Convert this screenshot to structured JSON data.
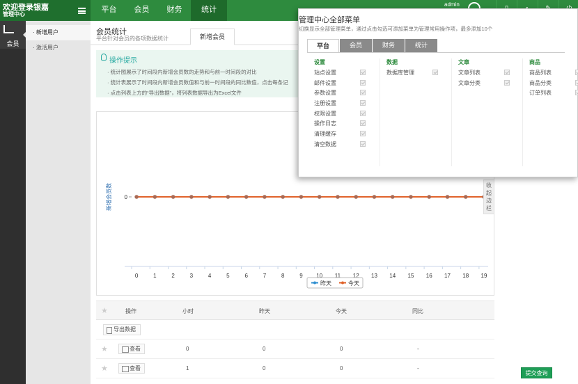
{
  "header": {
    "welcome": "欢迎登录银嘉",
    "center": "管理中心",
    "nav": [
      "平台",
      "会员",
      "财务",
      "统计"
    ],
    "active_nav": "统计",
    "admin": "admin"
  },
  "leftbar": {
    "label": "会员"
  },
  "subnav": [
    "新增用户",
    "激活用户"
  ],
  "page": {
    "title": "会员统计",
    "subtitle": "平台针对会员的各项数据统计",
    "tab": "新增会员"
  },
  "tips": {
    "title": "操作提示",
    "items": [
      "统计图展示了时间段内新增会员数的走势和与前一时间段的对比",
      "统计表展示了时间段内新增会员数值和与前一时间段的同比数值，点击每条记",
      "点击列表上方的“导出数据”，将列表数据导出为Excel文件"
    ]
  },
  "chart_data": {
    "type": "line",
    "x": [
      0,
      1,
      2,
      3,
      4,
      5,
      6,
      7,
      8,
      9,
      10,
      11,
      12,
      13,
      14,
      15,
      16,
      17,
      18,
      19
    ],
    "series": [
      {
        "name": "昨天",
        "color": "#2f8fd0",
        "values": [
          0,
          0,
          0,
          0,
          0,
          0,
          0,
          0,
          0,
          0,
          0,
          0,
          0,
          0,
          0,
          0,
          0,
          0,
          0,
          0
        ]
      },
      {
        "name": "今天",
        "color": "#e0622a",
        "values": [
          0,
          0,
          0,
          0,
          0,
          0,
          0,
          0,
          0,
          0,
          0,
          0,
          0,
          0,
          0,
          0,
          0,
          0,
          0,
          0
        ]
      }
    ],
    "ylabel": "新增会员数",
    "yticks": [
      0
    ],
    "legend": "bottom"
  },
  "collapse": "收起边栏",
  "table": {
    "headers": [
      "操作",
      "小时",
      "昨天",
      "今天",
      "同比"
    ],
    "export": "导出数据",
    "rows": [
      {
        "action": "查看",
        "hour": "0",
        "yesterday": "0",
        "today": "0",
        "yoy": "-"
      },
      {
        "action": "查看",
        "hour": "1",
        "yesterday": "0",
        "today": "0",
        "yoy": "-"
      }
    ]
  },
  "submit": "提交查询",
  "menu_panel": {
    "title": "管理中心全部菜单",
    "desc": "切换显示全部管理菜单，通过点击勾选可添加菜单为管理常用操作项，最多添加10个",
    "tabs": [
      "平台",
      "会员",
      "财务",
      "统计"
    ],
    "active_tab": "平台",
    "groups": [
      {
        "title": "设置",
        "items": [
          "站点设置",
          "邮件设置",
          "参数设置",
          "注册设置",
          "权限设置",
          "操作日志",
          "清理缓存",
          "清空数据"
        ]
      },
      {
        "title": "数据",
        "items": [
          "数据库管理"
        ]
      },
      {
        "title": "文章",
        "items": [
          "文章列表",
          "文章分类"
        ]
      },
      {
        "title": "商品",
        "items": [
          "商品列表",
          "商品分类",
          "订单列表"
        ]
      }
    ]
  }
}
